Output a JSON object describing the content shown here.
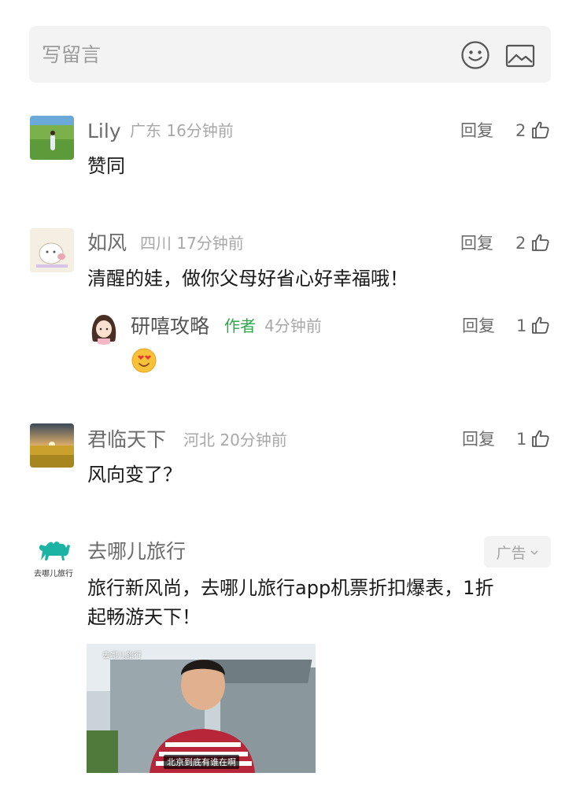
{
  "input": {
    "placeholder": "写留言",
    "emoji_icon": "smile-icon",
    "image_icon": "image-icon"
  },
  "comments": [
    {
      "name": "Lily",
      "location": "广东",
      "time": "16分钟前",
      "text": "赞同",
      "reply_label": "回复",
      "likes": "2"
    },
    {
      "name": "如风",
      "location": "四川",
      "time": "17分钟前",
      "text": "清醒的娃，做你父母好省心好幸福哦！",
      "reply_label": "回复",
      "likes": "2",
      "reply": {
        "name": "研嘻攻略",
        "author_tag": "作者",
        "time": "4分钟前",
        "emoji": "😍",
        "reply_label": "回复",
        "likes": "1"
      }
    },
    {
      "name": "君临天下",
      "location": "河北",
      "time": "20分钟前",
      "text": "风向变了？",
      "reply_label": "回复",
      "likes": "1"
    }
  ],
  "ad": {
    "advertiser": "去哪儿旅行",
    "logo_text": "去哪儿旅行",
    "tag": "广告",
    "text_line1": "旅行新风尚，去哪儿旅行app机票折扣爆表，1折",
    "text_line2": "起畅游天下！",
    "video_logo": "去哪儿旅行",
    "video_caption": "北京到底有谁在啊"
  },
  "colors": {
    "author_green": "#2aa84a",
    "brand_teal": "#1cb3a4"
  }
}
